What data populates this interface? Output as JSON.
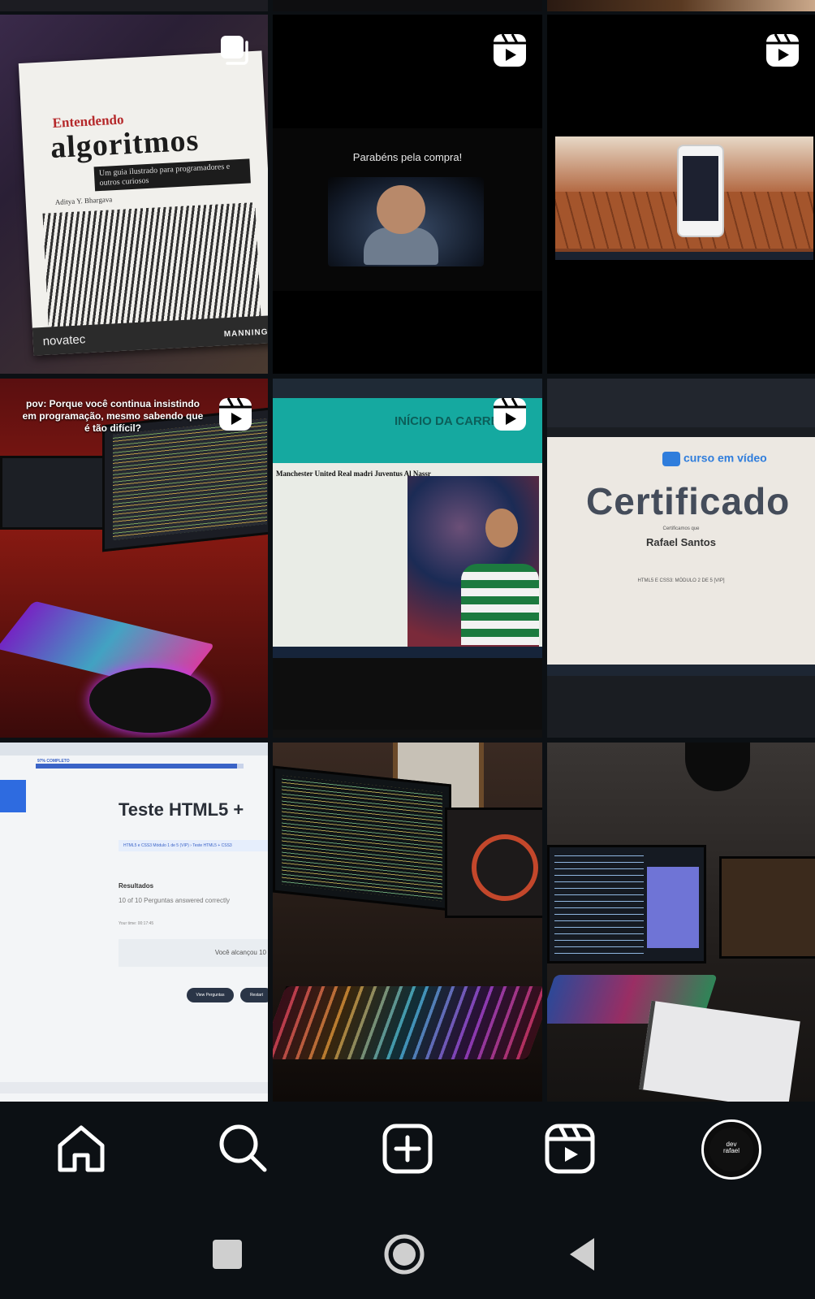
{
  "grid": {
    "posts": [
      {
        "type": "carousel",
        "badge": "carousel-icon",
        "content": {
          "title_small": "Entendendo",
          "title_big": "algoritmos",
          "subtitle": "Um guia ilustrado para programadores e outros curiosos",
          "author": "Aditya Y. Bhargava",
          "publisher": "novatec",
          "imprint": "MANNING"
        }
      },
      {
        "type": "reel",
        "badge": "reels-icon",
        "content": {
          "headline": "Parabéns pela compra!"
        }
      },
      {
        "type": "reel",
        "badge": "reels-icon",
        "content": {}
      },
      {
        "type": "reel",
        "badge": "reels-icon",
        "content": {
          "caption": "pov: Porque você continua insistindo em programação, mesmo sabendo que é tão difícil?"
        }
      },
      {
        "type": "reel",
        "badge": "reels-icon",
        "content": {
          "hero": "INÍCIO DA CARRE",
          "teams": "Manchester United   Real madri   Juventus   Al Nassr"
        }
      },
      {
        "type": "image",
        "content": {
          "logo": "curso em vídeo",
          "title": "Certificado",
          "certifies": "Certificamos que",
          "name": "Rafael Santos",
          "course": "HTML5 E CSS3: MÓDULO 2 DE 5 [VIP]"
        }
      },
      {
        "type": "image",
        "content": {
          "progress_label": "97% COMPLETO",
          "progress": 0.97,
          "title": "Teste HTML5 +",
          "breadcrumb": "HTML5 e CSS3 Módulo 1 de 5 (VIP) › Teste HTML5 + CSS3",
          "results": "Resultados",
          "answered": "10 of 10 Perguntas answered correctly",
          "time": "Your time: 00:17:45",
          "reached": "Você alcançou 10",
          "btn_view": "View Perguntas",
          "btn_restart": "Restart"
        }
      },
      {
        "type": "image",
        "content": {}
      },
      {
        "type": "image",
        "content": {}
      }
    ]
  },
  "nav": {
    "items": [
      {
        "name": "home",
        "icon": "home-icon"
      },
      {
        "name": "search",
        "icon": "search-icon"
      },
      {
        "name": "create",
        "icon": "plus-square-icon"
      },
      {
        "name": "reels",
        "icon": "reels-icon"
      },
      {
        "name": "profile",
        "icon": "avatar"
      }
    ],
    "avatar_label_1": "dev",
    "avatar_label_2": "rafael"
  },
  "system": {
    "buttons": [
      "recents-icon",
      "home-circle-icon",
      "back-icon"
    ]
  },
  "colors": {
    "background": "#0c1014",
    "icon": "#ffffff"
  }
}
